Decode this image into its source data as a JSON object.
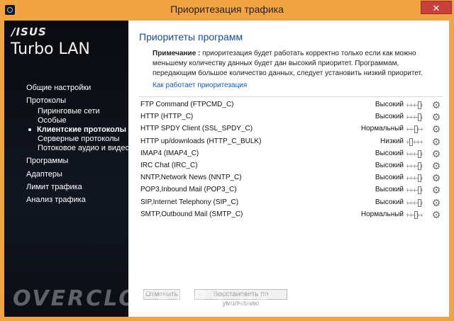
{
  "window": {
    "title": "Приоритезация трафика",
    "close_label": "✕"
  },
  "sidebar": {
    "logo": "/ISUS",
    "brand": "Turbo LAN",
    "items": [
      {
        "label": "Общие настройки"
      },
      {
        "label": "Протоколы"
      },
      {
        "label": "Пиринговые сети"
      },
      {
        "label": "Особые"
      },
      {
        "label": "Клиентские протоколы"
      },
      {
        "label": "Серверные протоколы"
      },
      {
        "label": "Потоковое аудио и видео"
      },
      {
        "label": "Программы"
      },
      {
        "label": "Адаптеры"
      },
      {
        "label": "Лимит трафика"
      },
      {
        "label": "Анализ трафика"
      }
    ]
  },
  "main": {
    "title": "Приоритеты программ",
    "note_bold": "Примечание :",
    "note_text": " приоритезация будет работать корректно только если как можно меньшему количеству данных будет дан высокий приоритет. Программам, передающим большое количество данных, следует установить низкий приоритет.",
    "link": "Как работает приоритезация",
    "rows": [
      {
        "name": "FTP Command (FTPCMD_C)",
        "priority": "Высокий",
        "level": 3
      },
      {
        "name": "HTTP (HTTP_C)",
        "priority": "Высокий",
        "level": 3
      },
      {
        "name": "HTTP SPDY Client (SSL_SPDY_C)",
        "priority": "Нормальный",
        "level": 2
      },
      {
        "name": "HTTP up/downloads (HTTP_C_BULK)",
        "priority": "Низкий",
        "level": 1
      },
      {
        "name": "IMAP4 (IMAP4_C)",
        "priority": "Высокий",
        "level": 3
      },
      {
        "name": "IRC Chat (IRC_C)",
        "priority": "Высокий",
        "level": 3
      },
      {
        "name": "NNTP,Network News (NNTP_C)",
        "priority": "Высокий",
        "level": 3
      },
      {
        "name": "POP3,Inbound Mail (POP3_C)",
        "priority": "Высокий",
        "level": 3
      },
      {
        "name": "SIP,Internet Telephony (SIP_C)",
        "priority": "Высокий",
        "level": 3
      },
      {
        "name": "SMTP,Outbound Mail (SMTP_C)",
        "priority": "Нормальный",
        "level": 2
      }
    ],
    "cancel_label": "Отменить",
    "restore_label": "Восстановить по умолчанию"
  },
  "watermark": "OVERCLOCKERS.ua",
  "colors": {
    "accent": "#1b4a95",
    "titlebar": "#f3a442",
    "close": "#c7413a"
  }
}
